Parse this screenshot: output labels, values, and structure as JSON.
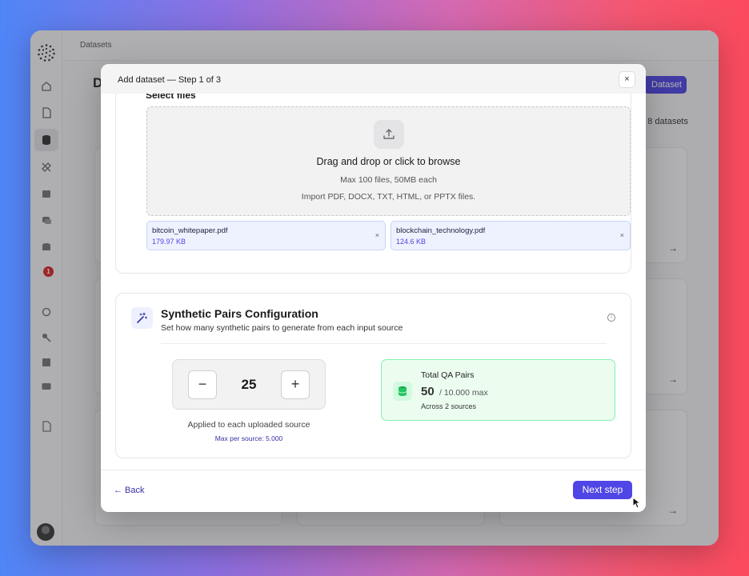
{
  "breadcrumb": "Datasets",
  "background": {
    "page_title_initial": "D",
    "add_button_label": "Dataset",
    "count_label": "8 datasets",
    "badge_count": "1"
  },
  "modal": {
    "title": "Add dataset — Step 1 of 3",
    "close_label": "×",
    "select_files": {
      "label": "Select files",
      "drop_main": "Drag and drop or click to browse",
      "drop_limit": "Max 100 files, 50MB each",
      "drop_types": "Import PDF, DOCX, TXT, HTML, or PPTX files.",
      "files": [
        {
          "name": "bitcoin_whitepaper.pdf",
          "size": "179.97 KB",
          "remove": "×"
        },
        {
          "name": "blockchain_technology.pdf",
          "size": "124.6 KB",
          "remove": "×"
        }
      ]
    },
    "synthetic": {
      "title": "Synthetic Pairs Configuration",
      "subtitle": "Set how many synthetic pairs to generate from each input source",
      "info": "i",
      "minus_label": "−",
      "plus_label": "+",
      "value": "25",
      "applied_text": "Applied to each uploaded source",
      "max_per_source": "Max per source: 5.000",
      "total_label": "Total QA Pairs",
      "total_value": "50",
      "total_max": "/ 10.000 max",
      "across": "Across 2 sources"
    },
    "footer": {
      "back_label": "← Back",
      "next_label": "Next step"
    }
  },
  "colors": {
    "accent": "#4f46e5",
    "success_bg": "#ecfdf0",
    "success_border": "#86efac"
  }
}
